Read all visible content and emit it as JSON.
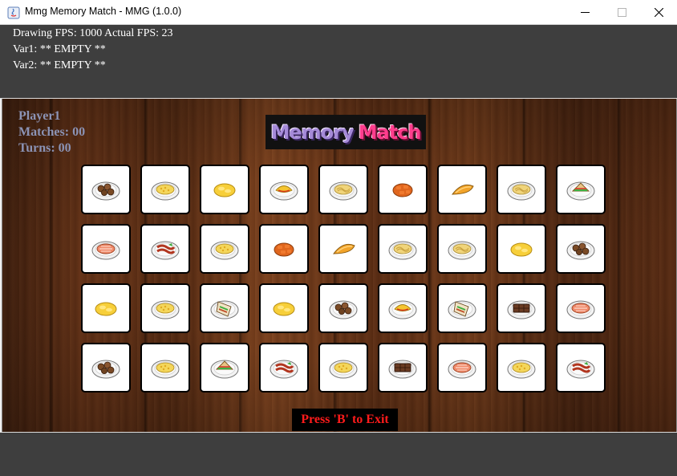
{
  "window": {
    "title": "Mmg Memory Match - MMG (1.0.0)",
    "controls": [
      "minimize-icon",
      "maximize-icon",
      "close-icon"
    ]
  },
  "debug": {
    "fps_line": "Drawing FPS: 1000 Actual FPS: 23",
    "var1_line": "Var1: ** EMPTY **",
    "var2_line": "Var2: ** EMPTY **"
  },
  "game": {
    "player_name": "Player1",
    "matches_line": "Matches: 00",
    "turns_line": "Turns: 00",
    "logo_word1": "Memory",
    "logo_word2": "Match",
    "exit_text": "Press 'B' to Exit",
    "cards": [
      [
        "meatballs",
        "mac-cheese",
        "scrambled-egg",
        "omelette",
        "pasta",
        "carrots",
        "potato-wedge",
        "pasta",
        "sandwich"
      ],
      [
        "salmon",
        "bacon",
        "mac-cheese",
        "carrots",
        "potato-wedge",
        "pasta",
        "pasta",
        "scrambled-egg",
        "meatballs"
      ],
      [
        "scrambled-egg",
        "mac-cheese",
        "wrap",
        "scrambled-egg",
        "meatballs",
        "omelette",
        "wrap",
        "chocolate",
        "salmon"
      ],
      [
        "meatballs",
        "mac-cheese",
        "sandwich",
        "bacon",
        "mac-cheese",
        "chocolate",
        "salmon",
        "mac-cheese",
        "bacon"
      ]
    ]
  },
  "colors": {
    "debug_bg": "#3e3e3e",
    "player_text": "#8b93b5",
    "exit_text": "#ff1b1b",
    "card_bg": "#ffffff",
    "card_border": "#000000"
  }
}
